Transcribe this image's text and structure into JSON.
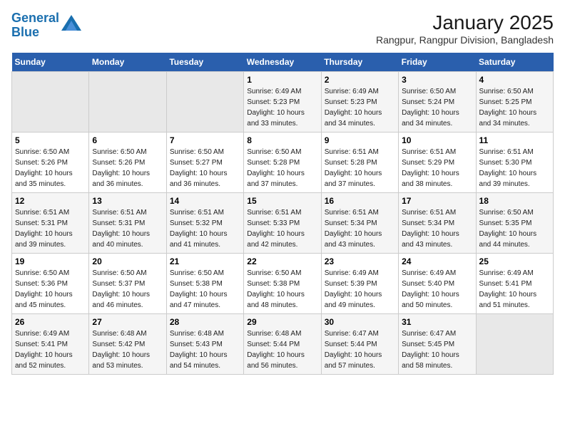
{
  "logo": {
    "line1": "General",
    "line2": "Blue"
  },
  "title": "January 2025",
  "subtitle": "Rangpur, Rangpur Division, Bangladesh",
  "weekdays": [
    "Sunday",
    "Monday",
    "Tuesday",
    "Wednesday",
    "Thursday",
    "Friday",
    "Saturday"
  ],
  "weeks": [
    [
      {
        "day": "",
        "info": ""
      },
      {
        "day": "",
        "info": ""
      },
      {
        "day": "",
        "info": ""
      },
      {
        "day": "1",
        "info": "Sunrise: 6:49 AM\nSunset: 5:23 PM\nDaylight: 10 hours\nand 33 minutes."
      },
      {
        "day": "2",
        "info": "Sunrise: 6:49 AM\nSunset: 5:23 PM\nDaylight: 10 hours\nand 34 minutes."
      },
      {
        "day": "3",
        "info": "Sunrise: 6:50 AM\nSunset: 5:24 PM\nDaylight: 10 hours\nand 34 minutes."
      },
      {
        "day": "4",
        "info": "Sunrise: 6:50 AM\nSunset: 5:25 PM\nDaylight: 10 hours\nand 34 minutes."
      }
    ],
    [
      {
        "day": "5",
        "info": "Sunrise: 6:50 AM\nSunset: 5:26 PM\nDaylight: 10 hours\nand 35 minutes."
      },
      {
        "day": "6",
        "info": "Sunrise: 6:50 AM\nSunset: 5:26 PM\nDaylight: 10 hours\nand 36 minutes."
      },
      {
        "day": "7",
        "info": "Sunrise: 6:50 AM\nSunset: 5:27 PM\nDaylight: 10 hours\nand 36 minutes."
      },
      {
        "day": "8",
        "info": "Sunrise: 6:50 AM\nSunset: 5:28 PM\nDaylight: 10 hours\nand 37 minutes."
      },
      {
        "day": "9",
        "info": "Sunrise: 6:51 AM\nSunset: 5:28 PM\nDaylight: 10 hours\nand 37 minutes."
      },
      {
        "day": "10",
        "info": "Sunrise: 6:51 AM\nSunset: 5:29 PM\nDaylight: 10 hours\nand 38 minutes."
      },
      {
        "day": "11",
        "info": "Sunrise: 6:51 AM\nSunset: 5:30 PM\nDaylight: 10 hours\nand 39 minutes."
      }
    ],
    [
      {
        "day": "12",
        "info": "Sunrise: 6:51 AM\nSunset: 5:31 PM\nDaylight: 10 hours\nand 39 minutes."
      },
      {
        "day": "13",
        "info": "Sunrise: 6:51 AM\nSunset: 5:31 PM\nDaylight: 10 hours\nand 40 minutes."
      },
      {
        "day": "14",
        "info": "Sunrise: 6:51 AM\nSunset: 5:32 PM\nDaylight: 10 hours\nand 41 minutes."
      },
      {
        "day": "15",
        "info": "Sunrise: 6:51 AM\nSunset: 5:33 PM\nDaylight: 10 hours\nand 42 minutes."
      },
      {
        "day": "16",
        "info": "Sunrise: 6:51 AM\nSunset: 5:34 PM\nDaylight: 10 hours\nand 43 minutes."
      },
      {
        "day": "17",
        "info": "Sunrise: 6:51 AM\nSunset: 5:34 PM\nDaylight: 10 hours\nand 43 minutes."
      },
      {
        "day": "18",
        "info": "Sunrise: 6:50 AM\nSunset: 5:35 PM\nDaylight: 10 hours\nand 44 minutes."
      }
    ],
    [
      {
        "day": "19",
        "info": "Sunrise: 6:50 AM\nSunset: 5:36 PM\nDaylight: 10 hours\nand 45 minutes."
      },
      {
        "day": "20",
        "info": "Sunrise: 6:50 AM\nSunset: 5:37 PM\nDaylight: 10 hours\nand 46 minutes."
      },
      {
        "day": "21",
        "info": "Sunrise: 6:50 AM\nSunset: 5:38 PM\nDaylight: 10 hours\nand 47 minutes."
      },
      {
        "day": "22",
        "info": "Sunrise: 6:50 AM\nSunset: 5:38 PM\nDaylight: 10 hours\nand 48 minutes."
      },
      {
        "day": "23",
        "info": "Sunrise: 6:49 AM\nSunset: 5:39 PM\nDaylight: 10 hours\nand 49 minutes."
      },
      {
        "day": "24",
        "info": "Sunrise: 6:49 AM\nSunset: 5:40 PM\nDaylight: 10 hours\nand 50 minutes."
      },
      {
        "day": "25",
        "info": "Sunrise: 6:49 AM\nSunset: 5:41 PM\nDaylight: 10 hours\nand 51 minutes."
      }
    ],
    [
      {
        "day": "26",
        "info": "Sunrise: 6:49 AM\nSunset: 5:41 PM\nDaylight: 10 hours\nand 52 minutes."
      },
      {
        "day": "27",
        "info": "Sunrise: 6:48 AM\nSunset: 5:42 PM\nDaylight: 10 hours\nand 53 minutes."
      },
      {
        "day": "28",
        "info": "Sunrise: 6:48 AM\nSunset: 5:43 PM\nDaylight: 10 hours\nand 54 minutes."
      },
      {
        "day": "29",
        "info": "Sunrise: 6:48 AM\nSunset: 5:44 PM\nDaylight: 10 hours\nand 56 minutes."
      },
      {
        "day": "30",
        "info": "Sunrise: 6:47 AM\nSunset: 5:44 PM\nDaylight: 10 hours\nand 57 minutes."
      },
      {
        "day": "31",
        "info": "Sunrise: 6:47 AM\nSunset: 5:45 PM\nDaylight: 10 hours\nand 58 minutes."
      },
      {
        "day": "",
        "info": ""
      }
    ]
  ]
}
